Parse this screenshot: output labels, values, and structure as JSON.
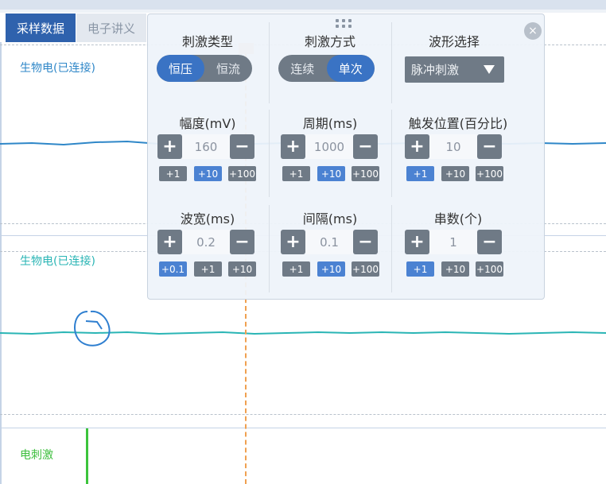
{
  "tabs": {
    "active": "采样数据",
    "inactive": "电子讲义"
  },
  "channels": [
    {
      "label": "生物电(已连接)",
      "color": "#2f87c8"
    },
    {
      "label": "生物电(已连接)",
      "color": "#2ab5b5"
    },
    {
      "label": "电刺激",
      "color": "#3cbe3c"
    }
  ],
  "panel": {
    "close_icon": "×",
    "stim_type": {
      "label": "刺激类型",
      "options": [
        "恒压",
        "恒流"
      ],
      "selected": "恒压"
    },
    "stim_mode": {
      "label": "刺激方式",
      "options": [
        "连续",
        "单次"
      ],
      "selected": "单次"
    },
    "waveform": {
      "label": "波形选择",
      "value": "脉冲刺激"
    },
    "amplitude": {
      "label": "幅度(mV)",
      "value": "160",
      "incs": [
        "+1",
        "+10",
        "+100"
      ],
      "selected": "+10"
    },
    "period": {
      "label": "周期(ms)",
      "value": "1000",
      "incs": [
        "+1",
        "+10",
        "+100"
      ],
      "selected": "+10"
    },
    "trigger": {
      "label": "触发位置(百分比)",
      "value": "10",
      "incs": [
        "+1",
        "+10",
        "+100"
      ],
      "selected": "+1"
    },
    "width": {
      "label": "波宽(ms)",
      "value": "0.2",
      "incs": [
        "+0.1",
        "+1",
        "+10"
      ],
      "selected": "+0.1"
    },
    "interval": {
      "label": "间隔(ms)",
      "value": "0.1",
      "incs": [
        "+1",
        "+10",
        "+100"
      ],
      "selected": "+10"
    },
    "count": {
      "label": "串数(个)",
      "value": "1",
      "incs": [
        "+1",
        "+10",
        "+100"
      ],
      "selected": "+1"
    },
    "plus_icon": "+",
    "minus_icon": "−"
  },
  "colors": {
    "accent": "#2f62ad",
    "button": "#6f7a86",
    "marker": "#f0a050"
  }
}
